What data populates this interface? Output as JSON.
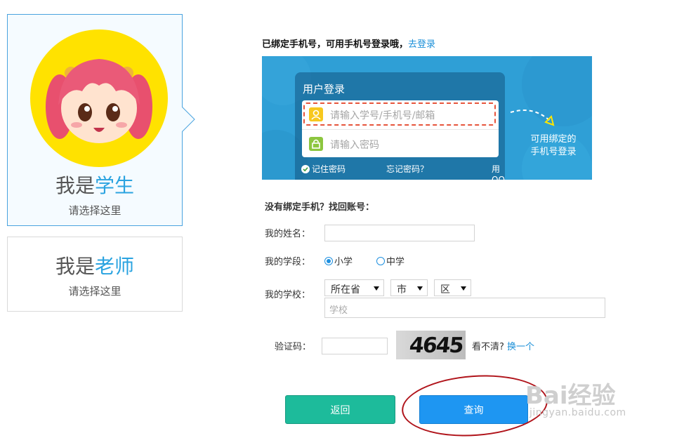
{
  "roles": {
    "student": {
      "prefix": "我是",
      "highlight": "学生",
      "subtitle": "请选择这里"
    },
    "teacher": {
      "prefix": "我是",
      "highlight": "老师",
      "subtitle": "请选择这里"
    }
  },
  "notice": {
    "text": "已绑定手机号，可用手机号登录哦，",
    "link": "去登录"
  },
  "login_demo": {
    "title": "用户登录",
    "account_placeholder": "请输入学号/手机号/邮箱",
    "password_placeholder": "请输入密码",
    "remember": "记住密码",
    "forgot": "忘记密码？",
    "qq_login": "用QQ登陆",
    "hint_line1": "可用绑定的",
    "hint_line2": "手机号登录"
  },
  "recover": {
    "title": "没有绑定手机？找回账号：",
    "name_label": "我的姓名：",
    "name_value": "",
    "grade_label": "我的学段：",
    "grade_options": [
      "小学",
      "中学"
    ],
    "grade_selected": "小学",
    "school_label": "我的学校：",
    "province": "所在省",
    "city": "市",
    "district": "区",
    "school_placeholder": "学校",
    "captcha_label": "验证码：",
    "captcha_value": "",
    "captcha_text": "4645",
    "unclear": "看不清?",
    "refresh": "换一个"
  },
  "buttons": {
    "back": "返回",
    "query": "查询"
  },
  "watermark": {
    "brand": "Bai经验",
    "url": "jingyan.baidu.com"
  },
  "colors": {
    "accent": "#2aa3e0",
    "banner": "#2f9fd6",
    "back_button": "#1dbb9b",
    "query_button": "#1e96f2",
    "highlight_circle": "#b0131a",
    "avatar_background": "#ffe200"
  }
}
